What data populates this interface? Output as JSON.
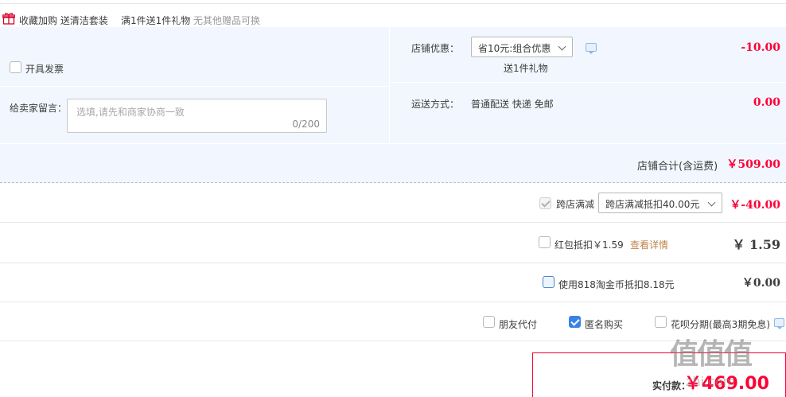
{
  "gift_row": {
    "icon": "gift-icon",
    "text1": "收藏加购 送清洁套装",
    "text2": "满1件送1件礼物",
    "text3": "无其他赠品可换"
  },
  "shop": {
    "invoice_label": "开具发票",
    "message_label": "给卖家留言：",
    "message_placeholder": "选填,请先和商家协商一致",
    "message_count": "0/200",
    "discount_label": "店铺优惠：",
    "discount_select": "省10元:组合优惠",
    "discount_note": "送1件礼物",
    "discount_amount": "-10.00",
    "shipping_label": "运送方式：",
    "shipping_value": "普通配送 快递 免邮",
    "shipping_amount": "0.00",
    "total_label": "店铺合计(含运费)",
    "total_amount": "￥509.00"
  },
  "cross_store": {
    "label": "跨店满减",
    "select": "跨店满减抵扣40.00元",
    "amount": "￥-40.00"
  },
  "red_packet": {
    "label": "红包抵扣￥1.59",
    "link": "查看详情",
    "amount": "￥ 1.59"
  },
  "coins": {
    "label": "使用818淘金币抵扣8.18元",
    "amount": "￥0.00"
  },
  "options": {
    "friend_pay": "朋友代付",
    "anonymous": "匿名购买",
    "huabei": "花呗分期(最高3期免息)"
  },
  "payment": {
    "label": "实付款：",
    "amount": "￥469.00"
  },
  "watermark": {
    "brand": "值值值",
    "url": "zhi.com"
  },
  "colors": {
    "accent_red": "#ff0036",
    "panel_blue": "#f2f7ff",
    "check_blue": "#3a82e6"
  }
}
